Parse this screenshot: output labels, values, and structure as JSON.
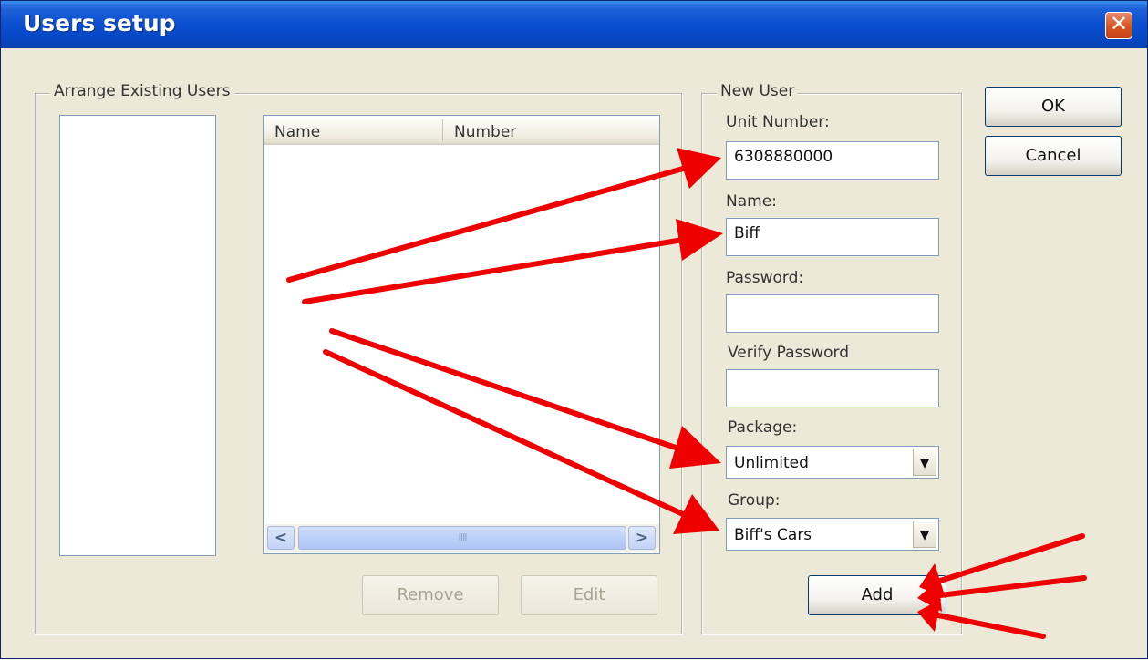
{
  "window": {
    "title": "Users setup",
    "close_label": "✕"
  },
  "arrange_group": {
    "legend": "Arrange Existing Users",
    "columns": [
      "Name",
      "Number"
    ],
    "scroll_thumb_grip": "IIII",
    "remove_label": "Remove",
    "edit_label": "Edit"
  },
  "new_user": {
    "legend": "New User",
    "unit_number_label": "Unit Number:",
    "unit_number_value": "6308880000",
    "name_label": "Name:",
    "name_value": "Biff",
    "password_label": "Password:",
    "password_value": "",
    "verify_password_label": "Verify Password",
    "verify_password_value": "",
    "package_label": "Package:",
    "package_value": "Unlimited",
    "group_label": "Group:",
    "group_value": "Biff's Cars",
    "add_label": "Add"
  },
  "dialog_buttons": {
    "ok_label": "OK",
    "cancel_label": "Cancel"
  },
  "icons": {
    "scroll_left": "<",
    "scroll_right": ">",
    "dropdown": "▼"
  },
  "colors": {
    "title_bar": "#0a4fd1",
    "dialog_bg": "#ece9d8",
    "close_button": "#d8531f",
    "annotation_arrow": "#ee0000"
  }
}
